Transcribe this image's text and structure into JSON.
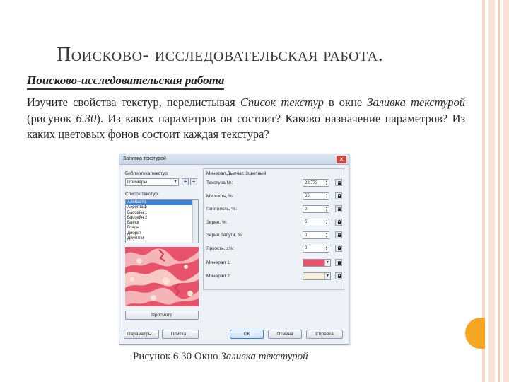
{
  "slide": {
    "title": "Поисково- исследовательская работа."
  },
  "book": {
    "heading": "Поисково-исследовательская работа",
    "text_1": "Изучите свойства текстур, перелистывая ",
    "text_2": "Список текстур",
    "text_3": " в окне ",
    "text_4": "Заливка текстурой",
    "text_5": " (рисунок ",
    "text_6": "6.30",
    "text_7": "). Из каких параметров он состоит? Каково назначение параметров? Из каких цветовых фонов состоит каждая текстура?",
    "caption_prefix": "Рисунок 6.30 Окно ",
    "caption_italic": "Заливка текстурой"
  },
  "dialog": {
    "title": "Заливка текстурой",
    "close_glyph": "✕",
    "library_label": "Библиотека текстур:",
    "library_value": "Примеры",
    "add_glyph": "+",
    "remove_glyph": "−",
    "list_label": "Список текстур:",
    "texture_list": [
      "Алебастр",
      "Аэрограф",
      "Бассейн 1",
      "Бассейн 2",
      "Блеск",
      "Гладь",
      "Диорит",
      "Джунгли"
    ],
    "selected_index": 0,
    "preview_button": "Просмотр",
    "texture_name": "Минерал.Дымчат. 2цветный",
    "params": [
      {
        "label": "Текстура №:",
        "value": "22.773"
      },
      {
        "label": "Мягкость, %:",
        "value": "65"
      },
      {
        "label": "Плотность, %:",
        "value": "0"
      },
      {
        "label": "Зерно, %:",
        "value": "0"
      },
      {
        "label": "Зерно радуги, %:",
        "value": "0"
      },
      {
        "label": "Яркость, ±%:",
        "value": "0"
      }
    ],
    "colors": [
      {
        "label": "Минерал 1:",
        "color": "#e8526a"
      },
      {
        "label": "Минерал 2:",
        "color": "#f8efdb"
      }
    ],
    "buttons": {
      "params": "Параметры...",
      "tiling": "Плитка...",
      "ok": "ОК",
      "cancel": "Отмена",
      "help": "Справка"
    }
  }
}
